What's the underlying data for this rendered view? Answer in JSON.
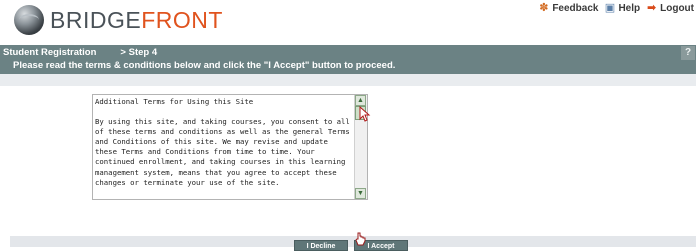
{
  "header": {
    "logo_prefix": "BRIDGE",
    "logo_accent": "FRONT",
    "links": [
      {
        "label": "Feedback",
        "icon": "feedback-icon"
      },
      {
        "label": "Help",
        "icon": "help-icon"
      },
      {
        "label": "Logout",
        "icon": "logout-icon"
      }
    ]
  },
  "breadcrumb": {
    "section": "Student Registration",
    "step": "> Step 4",
    "instruction": "Please read the terms & conditions below and click the \"I Accept\" button to proceed.",
    "help_label": "?"
  },
  "terms": {
    "title": "Additional Terms for Using this Site",
    "body": "By using this site, and taking courses, you consent to all\nof these terms and conditions as well as the general Terms\nand Conditions of this site. We may revise and update\nthese Terms and Conditions from time to time. Your\ncontinued enrollment, and taking courses in this learning\nmanagement system, means that you agree to accept these\nchanges or terminate your use of the site."
  },
  "actions": {
    "decline_label": "I Decline",
    "accept_label": "I Accept"
  },
  "colors": {
    "bar": "#6b8284",
    "accent": "#e0531e",
    "button": "#5f7678"
  }
}
